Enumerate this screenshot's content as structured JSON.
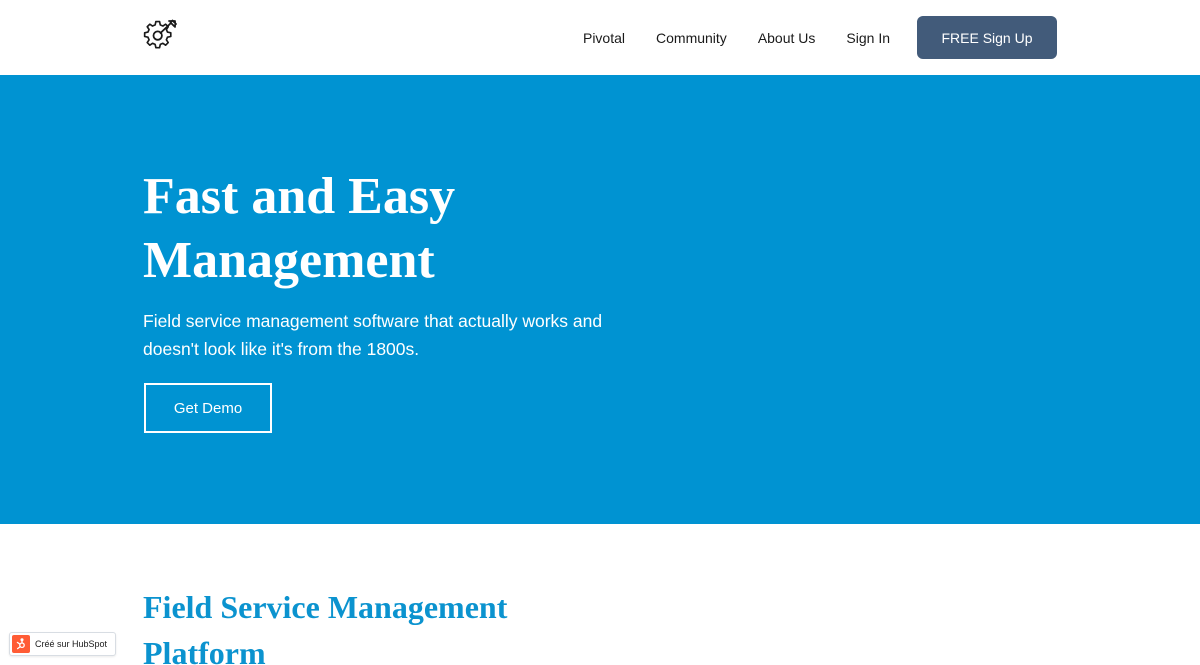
{
  "header": {
    "logo_icon": "gear-wrench-icon",
    "nav": {
      "pivotal": "Pivotal",
      "community": "Community",
      "about_us": "About Us",
      "sign_in": "Sign In"
    },
    "signup_label": "FREE Sign Up"
  },
  "hero": {
    "title_line1": "Fast and Easy",
    "title_line2": "Management",
    "subtitle_line1": "Field service management software that actually works and",
    "subtitle_line2": "doesn't look like it's from the 1800s.",
    "cta_label": "Get Demo"
  },
  "section": {
    "title_line1": "Field Service Management",
    "title_line2": "Platform"
  },
  "badge": {
    "label": "Créé sur HubSpot",
    "icon": "hubspot-sprocket-icon"
  },
  "colors": {
    "hero_background": "#0093d2",
    "signup_button": "#425b7a",
    "section_title": "#0b93cf",
    "hubspot_orange": "#ff5c35"
  }
}
